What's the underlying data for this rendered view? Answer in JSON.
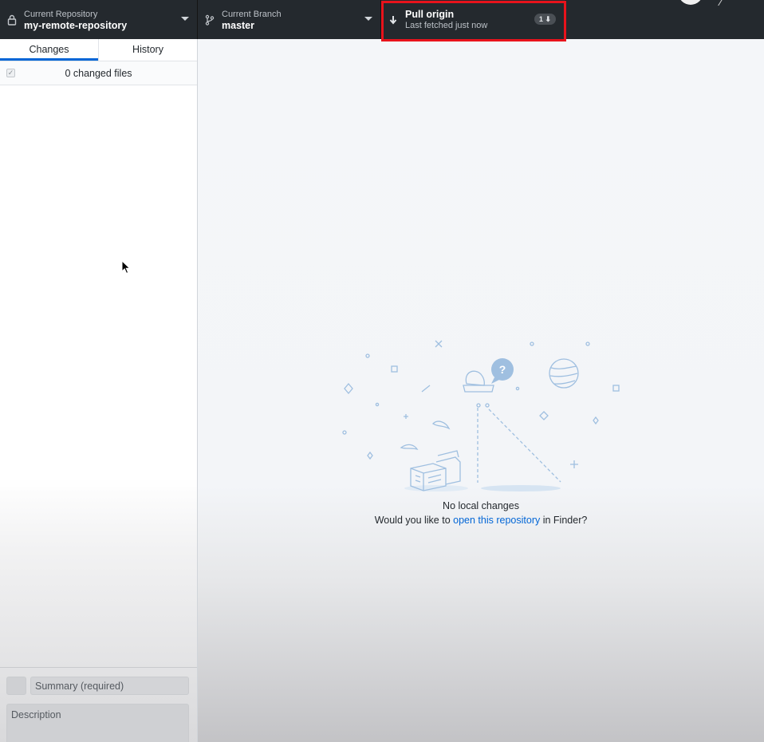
{
  "toolbar": {
    "repository": {
      "label": "Current Repository",
      "value": "my-remote-repository",
      "icon": "lock-icon"
    },
    "branch": {
      "label": "Current Branch",
      "value": "master",
      "icon": "git-branch-icon"
    },
    "pull": {
      "title": "Pull origin",
      "subtitle": "Last fetched just now",
      "badge": "1",
      "icon": "arrow-down-icon"
    }
  },
  "sidebar": {
    "tabs": [
      {
        "label": "Changes",
        "active": true
      },
      {
        "label": "History",
        "active": false
      }
    ],
    "changes_count": "0 changed files",
    "commit": {
      "summary_placeholder": "Summary (required)",
      "description_placeholder": "Description"
    }
  },
  "main": {
    "blank_slate_title": "No local changes",
    "blank_slate_prefix": "Would you like to",
    "blank_slate_link": "open this repository",
    "blank_slate_suffix": "in Finder?"
  },
  "colors": {
    "toolbar_bg": "#24292e",
    "accent": "#0366d6",
    "highlight": "#e8131c",
    "illustration": "#9fbfe0"
  }
}
